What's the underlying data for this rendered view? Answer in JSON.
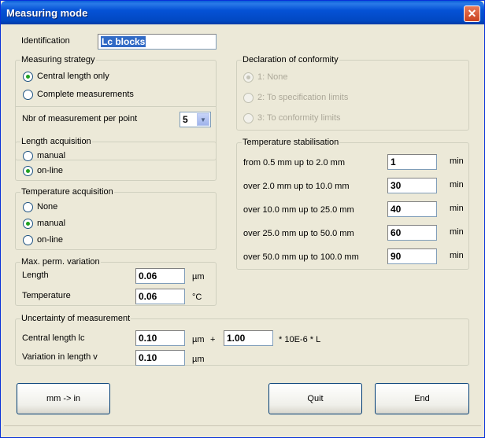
{
  "window": {
    "title": "Measuring mode",
    "close_glyph": "✕"
  },
  "identification": {
    "label": "Identification",
    "value": "Lc blocks"
  },
  "measuring_strategy": {
    "legend": "Measuring strategy",
    "options": [
      {
        "label": "Central length only",
        "checked": true
      },
      {
        "label": "Complete measurements",
        "checked": false
      }
    ],
    "nbr_label": "Nbr of measurement per point",
    "nbr_value": "5"
  },
  "length_acquisition": {
    "legend": "Length acquisition",
    "options": [
      {
        "label": "manual",
        "checked": false
      },
      {
        "label": "on-line",
        "checked": true
      }
    ]
  },
  "temperature_acquisition": {
    "legend": "Temperature acquisition",
    "options": [
      {
        "label": "None",
        "checked": false
      },
      {
        "label": "manual",
        "checked": true
      },
      {
        "label": "on-line",
        "checked": false
      }
    ]
  },
  "max_variation": {
    "legend": "Max. perm. variation",
    "length_label": "Length",
    "length_value": "0.06",
    "length_unit": "µm",
    "temp_label": "Temperature",
    "temp_value": "0.06",
    "temp_unit": "°C"
  },
  "conformity": {
    "legend": "Declaration of conformity",
    "options": [
      {
        "label": "1: None",
        "checked": true
      },
      {
        "label": "2: To specification limits",
        "checked": false
      },
      {
        "label": "3: To conformity limits",
        "checked": false
      }
    ]
  },
  "temp_stabilisation": {
    "legend": "Temperature stabilisation",
    "unit": "min",
    "rows": [
      {
        "label": "from 0.5 mm up to 2.0 mm",
        "value": "1"
      },
      {
        "label": "over 2.0 mm up to 10.0 mm",
        "value": "30"
      },
      {
        "label": "over 10.0 mm up to 25.0 mm",
        "value": "40"
      },
      {
        "label": "over 25.0 mm up to 50.0 mm",
        "value": "60"
      },
      {
        "label": "over 50.0 mm up to 100.0 mm",
        "value": "90"
      }
    ]
  },
  "uncertainty": {
    "legend": "Uncertainty of measurement",
    "central_label": "Central length lc",
    "central_value": "0.10",
    "central_unit": "µm",
    "plus": "+",
    "factor_value": "1.00",
    "factor_suffix": "* 10E-6 * L",
    "variation_label": "Variation in length v",
    "variation_value": "0.10",
    "variation_unit": "µm"
  },
  "buttons": {
    "convert": "mm -> in",
    "quit": "Quit",
    "end": "End"
  }
}
